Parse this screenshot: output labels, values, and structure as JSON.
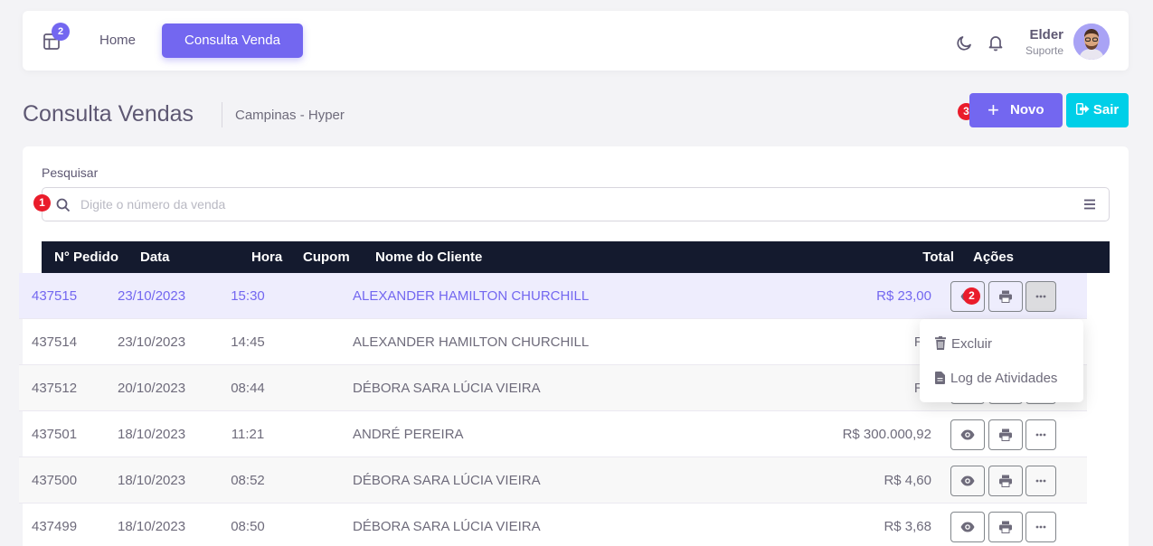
{
  "navbar": {
    "badge": "2",
    "home": "Home",
    "active": "Consulta Venda",
    "user_name": "Elder",
    "user_role": "Suporte"
  },
  "page": {
    "title": "Consulta Vendas",
    "subtitle": "Campinas - Hyper",
    "new_button": "Novo",
    "exit_button": "Sair"
  },
  "markers": [
    "1",
    "2",
    "3"
  ],
  "search": {
    "label": "Pesquisar",
    "placeholder": "Digite o número da venda",
    "value": ""
  },
  "table": {
    "headers": [
      "N° Pedido",
      "Data",
      "Hora",
      "Cupom",
      "Nome do Cliente",
      "Total",
      "Ações"
    ],
    "rows": [
      {
        "pedido": "437515",
        "data": "23/10/2023",
        "hora": "15:30",
        "cupom": "",
        "cliente": "ALEXANDER HAMILTON CHURCHILL",
        "total": "R$ 23,00"
      },
      {
        "pedido": "437514",
        "data": "23/10/2023",
        "hora": "14:45",
        "cupom": "",
        "cliente": "ALEXANDER HAMILTON CHURCHILL",
        "total": "R$"
      },
      {
        "pedido": "437512",
        "data": "20/10/2023",
        "hora": "08:44",
        "cupom": "",
        "cliente": "DÉBORA SARA LÚCIA VIEIRA",
        "total": "R$"
      },
      {
        "pedido": "437501",
        "data": "18/10/2023",
        "hora": "11:21",
        "cupom": "",
        "cliente": "ANDRÉ PEREIRA",
        "total": "R$ 300.000,92"
      },
      {
        "pedido": "437500",
        "data": "18/10/2023",
        "hora": "08:52",
        "cupom": "",
        "cliente": "DÉBORA SARA LÚCIA VIEIRA",
        "total": "R$ 4,60"
      },
      {
        "pedido": "437499",
        "data": "18/10/2023",
        "hora": "08:50",
        "cupom": "",
        "cliente": "DÉBORA SARA LÚCIA VIEIRA",
        "total": "R$ 3,68"
      }
    ]
  },
  "dropdown": {
    "delete": "Excluir",
    "log": "Log de Atividades"
  },
  "colors": {
    "primary": "#7367f0",
    "info": "#00cfe8",
    "danger": "#ea1c2b",
    "header_dark": "#141a2e"
  }
}
